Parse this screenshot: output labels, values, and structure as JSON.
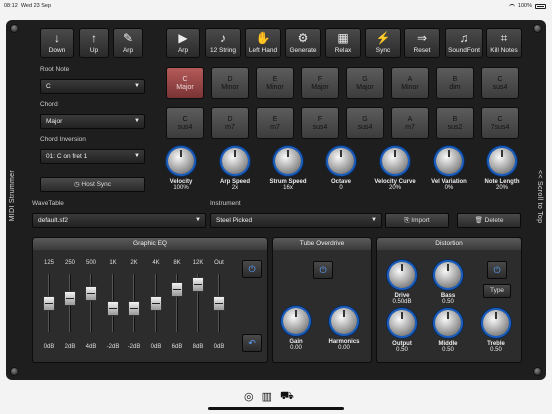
{
  "status": {
    "time": "08:12",
    "date": "Wed 23 Sep",
    "battery": "100%"
  },
  "side": {
    "left": "MIDI Strummer",
    "right": "<< Scroll to Top"
  },
  "toolbar": [
    {
      "label": "Down",
      "icon": "arrow-down-icon",
      "glyph": "↓"
    },
    {
      "label": "Up",
      "icon": "arrow-up-icon",
      "glyph": "↑"
    },
    {
      "label": "Arp",
      "icon": "arp-wand-icon",
      "glyph": "✎"
    },
    {
      "label": "Arp",
      "icon": "play-circle-icon",
      "glyph": "▶"
    },
    {
      "label": "12 String",
      "icon": "guitar-icon",
      "glyph": "♪"
    },
    {
      "label": "Left Hand",
      "icon": "hand-icon",
      "glyph": "✋"
    },
    {
      "label": "Generate",
      "icon": "generate-icon",
      "glyph": "⚙"
    },
    {
      "label": "Relax",
      "icon": "chord-grid-icon",
      "glyph": "▦"
    },
    {
      "label": "Sync",
      "icon": "sync-icon",
      "glyph": "⚡"
    },
    {
      "label": "Reset",
      "icon": "reset-arrow-icon",
      "glyph": "⇒"
    },
    {
      "label": "SoundFont",
      "icon": "soundfont-guitar-icon",
      "glyph": "♫"
    },
    {
      "label": "Kill Notes",
      "icon": "kill-notes-icon",
      "glyph": "⌗"
    }
  ],
  "root_note": {
    "label": "Root Note",
    "value": "C"
  },
  "chord": {
    "label": "Chord",
    "value": "Major"
  },
  "chord_inversion": {
    "label": "Chord Inversion",
    "value": "01: C on fret 1"
  },
  "host_sync": "Host Sync",
  "pads_row1": [
    {
      "note": "C",
      "type": "Major",
      "active": true
    },
    {
      "note": "D",
      "type": "Minor"
    },
    {
      "note": "E",
      "type": "Minor"
    },
    {
      "note": "F",
      "type": "Major"
    },
    {
      "note": "G",
      "type": "Major"
    },
    {
      "note": "A",
      "type": "Minor"
    },
    {
      "note": "B",
      "type": "dim"
    },
    {
      "note": "C",
      "type": "sus4"
    }
  ],
  "pads_row2": [
    {
      "note": "C",
      "type": "sus4"
    },
    {
      "note": "D",
      "type": "m7"
    },
    {
      "note": "E",
      "type": "m7"
    },
    {
      "note": "F",
      "type": "sus4"
    },
    {
      "note": "G",
      "type": "sus4"
    },
    {
      "note": "A",
      "type": "m7"
    },
    {
      "note": "B",
      "type": "sus2"
    },
    {
      "note": "C",
      "type": "7sus4"
    }
  ],
  "knobs": [
    {
      "name": "Velocity",
      "value": "100%"
    },
    {
      "name": "Arp Speed",
      "value": "2x"
    },
    {
      "name": "Strum Speed",
      "value": "16x"
    },
    {
      "name": "Octave",
      "value": "0"
    },
    {
      "name": "Velocity Curve",
      "value": "20%"
    },
    {
      "name": "Vel Variation",
      "value": "0%"
    },
    {
      "name": "Note Length",
      "value": "20%"
    }
  ],
  "wavetable": {
    "label": "WaveTable",
    "value": "default.sf2"
  },
  "instrument": {
    "label": "Instrument",
    "value": "Steel Picked"
  },
  "import_label": "Import",
  "delete_label": "Delete",
  "eq": {
    "title": "Graphic EQ",
    "bands": [
      "125",
      "250",
      "500",
      "1K",
      "2K",
      "4K",
      "8K",
      "12K",
      "Out"
    ],
    "gains": [
      "0dB",
      "2dB",
      "4dB",
      "-2dB",
      "-2dB",
      "0dB",
      "6dB",
      "8dB",
      "0dB"
    ],
    "levels": [
      0,
      2,
      4,
      -2,
      -2,
      0,
      6,
      8,
      0
    ]
  },
  "tube": {
    "title": "Tube Overdrive",
    "knobs": [
      {
        "name": "Gain",
        "value": "0.00"
      },
      {
        "name": "Harmonics",
        "value": "0.00"
      }
    ]
  },
  "distortion": {
    "title": "Distortion",
    "type_label": "Type",
    "knobs": [
      {
        "name": "Drive",
        "value": "0.50dB"
      },
      {
        "name": "Bass",
        "value": "0.50"
      },
      {
        "name": "Output",
        "value": "0.50"
      },
      {
        "name": "Middle",
        "value": "0.50"
      },
      {
        "name": "Treble",
        "value": "0.50"
      }
    ]
  },
  "colors": {
    "accent": "#1a5fbf",
    "active_pad": "#b55a5a",
    "background": "#1e1e1e"
  }
}
